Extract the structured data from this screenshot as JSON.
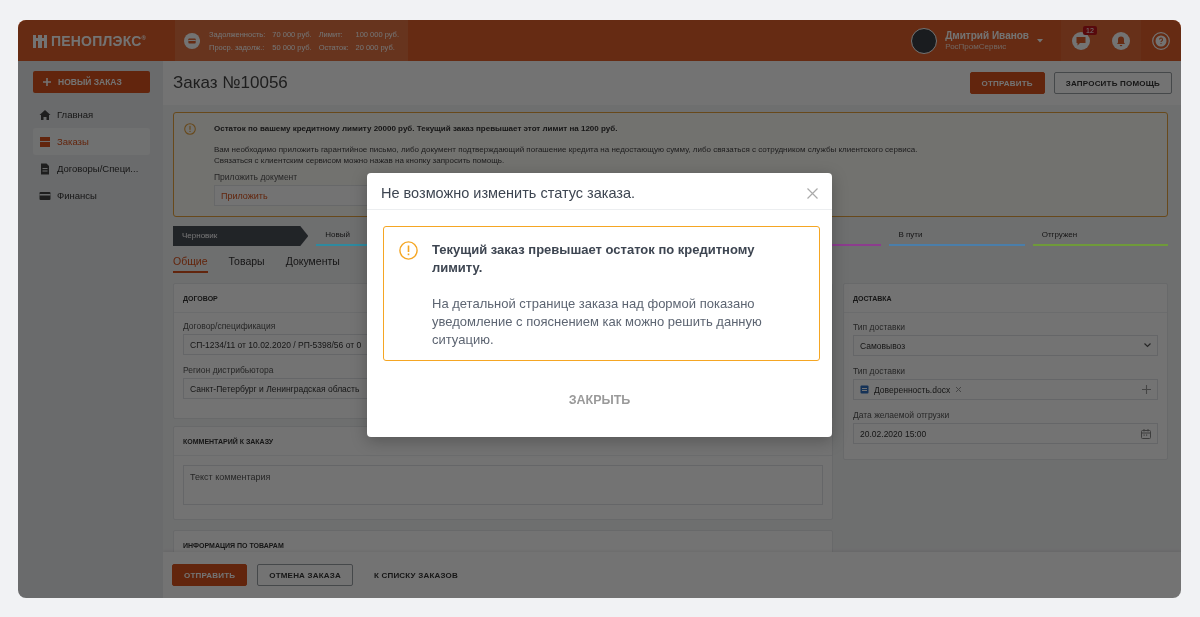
{
  "header": {
    "logo": "ПЕНОПЛЭКС$^{®}$",
    "credit": [
      {
        "label": "Задолженность:",
        "value": "70 000 руб."
      },
      {
        "label": "Лимит:",
        "value": "100 000 руб."
      },
      {
        "label": "Проср. задолж.:",
        "value": "50 000 руб."
      },
      {
        "label": "Остаток:",
        "value": "20 000 руб."
      }
    ],
    "user": {
      "name": "Дмитрий Иванов",
      "company": "РосПромСервис"
    },
    "messages_badge": "12"
  },
  "sidebar": {
    "new_order_button": "НОВЫЙ ЗАКАЗ",
    "items": [
      {
        "label": "Главная",
        "selected": false
      },
      {
        "label": "Заказы",
        "selected": true
      },
      {
        "label": "Договоры/Специ...",
        "selected": false
      },
      {
        "label": "Финансы",
        "selected": false
      }
    ]
  },
  "page": {
    "title": "Заказ №10056",
    "actions": [
      {
        "kind": "primary",
        "label": "ОТПРАВИТЬ"
      },
      {
        "kind": "outline",
        "label": "ЗАПРОСИТЬ ПОМОЩЬ"
      }
    ]
  },
  "credit_warning": {
    "title": "Остаток по вашему кредитному лимиту 20000 руб. Текущий заказ превышает этот лимит на 1200 руб.",
    "lines": [
      "Вам необходимо приложить гарантийное письмо, либо документ подтверждающий погашение кредита на недостающую сумму, либо связаться с сотрудником службы клиентского сервиса.",
      "Связаться с клиентским сервисом можно нажав на кнопку запросить помощь."
    ],
    "attach_label": "Приложить документ",
    "attach_button": "Приложить"
  },
  "stages": [
    {
      "label": "Черновик",
      "selected": true,
      "color": "#4b5058"
    },
    {
      "label": "Новый",
      "selected": false,
      "color": "#2e8aa0"
    },
    {
      "selected": false,
      "color": "#8c3c8e"
    },
    {
      "label": "В пути",
      "selected": false,
      "color": "#4a7eaa"
    },
    {
      "label": "Отгружен",
      "selected": false,
      "color": "#6f9a3a"
    }
  ],
  "tabs": [
    {
      "label": "Общие",
      "selected": true
    },
    {
      "label": "Товары",
      "selected": false
    },
    {
      "label": "Документы",
      "selected": false
    }
  ],
  "contract_card": {
    "title": "ДОГОВОР",
    "fields": [
      {
        "label": "Договор/спецификация",
        "value": "СП-1234/11 от 10.02.2020 / РП-5398/56 от 0"
      },
      {
        "label": "Регион дистрибьютора",
        "value": "Санкт-Петербург и Ленинградская область"
      }
    ]
  },
  "comment_card": {
    "title": "КОММЕНТАРИЙ К ЗАКАЗУ",
    "placeholder": "Текст комментария"
  },
  "products_card": {
    "title": "ИНФОРМАЦИЯ ПО ТОВАРАМ"
  },
  "delivery_card": {
    "title": "ДОСТАВКА",
    "fields": [
      {
        "kind": "select",
        "label": "Тип доставки",
        "value": "Самовывоз"
      },
      {
        "kind": "file",
        "label": "Тип доставки",
        "value": "Доверенность.docx"
      },
      {
        "kind": "date",
        "label": "Дата желаемой отгрузки",
        "value": "20.02.2020 15:00"
      }
    ]
  },
  "footer": {
    "buttons": [
      {
        "kind": "primary",
        "label": "ОТПРАВИТЬ"
      },
      {
        "kind": "outline",
        "label": "ОТМЕНА ЗАКАЗА"
      },
      {
        "kind": "link",
        "label": "К СПИСКУ ЗАКАЗОВ"
      }
    ]
  },
  "dialog": {
    "title": "Не возможно изменить статус заказа.",
    "alert_title": "Текущий заказ превышает остаток по кредитному лимиту.",
    "alert_text": "На детальной странице заказа над формой показано уведомление с пояснением как можно решить данную ситуацию.",
    "button": "ЗАКРЫТЬ"
  }
}
